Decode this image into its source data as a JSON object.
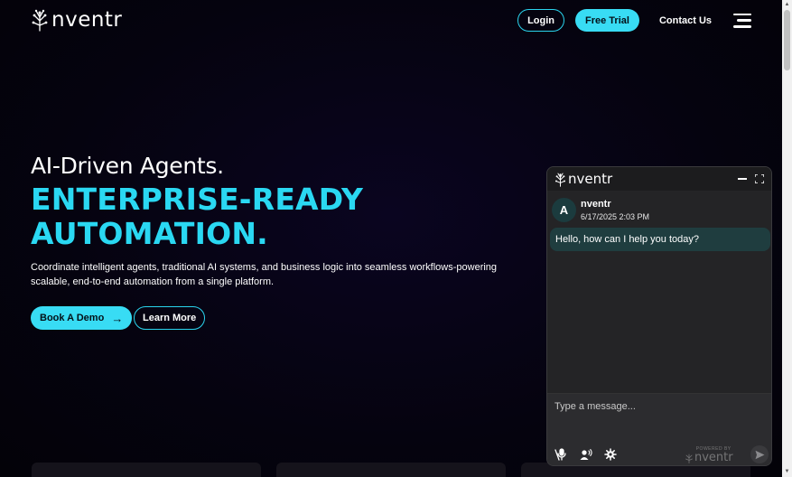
{
  "header": {
    "logo_text": "nventr",
    "login_label": "Login",
    "trial_label": "Free Trial",
    "contact_label": "Contact Us",
    "menu_icon": "hamburger-menu-icon"
  },
  "hero": {
    "kicker": "AI-Driven Agents.",
    "title_line1": "ENTERPRISE-READY",
    "title_line2": "AUTOMATION.",
    "description": "Coordinate intelligent agents, traditional AI systems, and business logic into seamless workflows-powering scalable, end-to-end automation from a single platform.",
    "demo_label": "Book A Demo",
    "demo_icon": "arrow-right-icon",
    "learn_label": "Learn More"
  },
  "chat": {
    "title": "nventr",
    "avatar_letter": "A",
    "sender": "nventr",
    "timestamp": "6/17/2025 2:03 PM",
    "message": "Hello, how can I help you today?",
    "input_placeholder": "Type a message...",
    "powered_by": "POWERED BY",
    "powered_name": "nventr"
  },
  "colors": {
    "accent": "#38dcf4",
    "background": "#05030d",
    "chat_panel": "#242426",
    "bubble": "#1f3d3f"
  }
}
